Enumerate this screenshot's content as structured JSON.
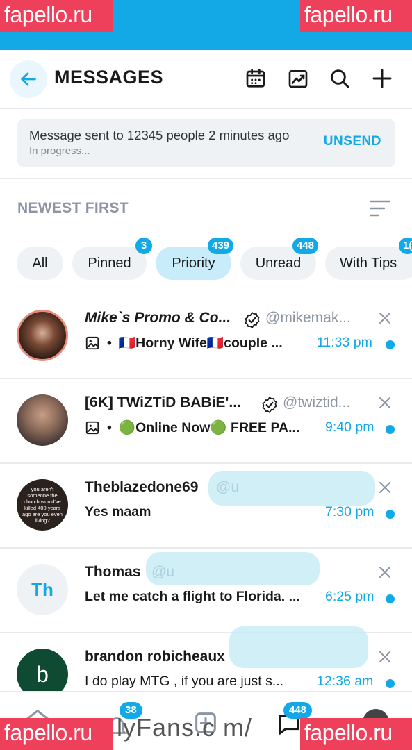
{
  "header": {
    "title": "MESSAGES"
  },
  "banner": {
    "message": "Message sent to 12345 people 2 minutes ago",
    "status": "In progress...",
    "action": "UNSEND"
  },
  "sort": {
    "label": "NEWEST FIRST"
  },
  "filters": [
    {
      "label": "All",
      "badge": null,
      "active": false
    },
    {
      "label": "Pinned",
      "badge": "3",
      "active": false
    },
    {
      "label": "Priority",
      "badge": "439",
      "active": true
    },
    {
      "label": "Unread",
      "badge": "448",
      "active": false
    },
    {
      "label": "With Tips",
      "badge": "1(",
      "active": false
    }
  ],
  "conversations": [
    {
      "name": "Mike`s Promo & Co...",
      "verified": true,
      "handle": "@mikemak...",
      "preview": "🇫🇷Horny Wife🇫🇷couple ...",
      "has_media_icon": true,
      "time": "11:33 pm",
      "unread": true
    },
    {
      "name": "[6K] TWiZTiD BABiE'...",
      "verified": true,
      "handle": "@twiztid...",
      "preview": "🟢Online Now🟢 FREE PA...",
      "has_media_icon": true,
      "time": "9:40 pm",
      "unread": true
    },
    {
      "name": "Theblazedone69",
      "verified": false,
      "handle": "@u",
      "preview": "Yes maam",
      "has_media_icon": false,
      "time": "7:30 pm",
      "unread": true,
      "avatar_text": "you aren't someone the church would've killed 400 years ago are you even living?"
    },
    {
      "name": "Thomas",
      "verified": false,
      "handle": "@u",
      "preview": "Let me catch a flight to Florida. ...",
      "has_media_icon": false,
      "time": "6:25 pm",
      "unread": true,
      "avatar_initials": "Th"
    },
    {
      "name": "brandon robicheaux",
      "verified": false,
      "handle": "",
      "preview": "I do play MTG , if you are just s...",
      "has_media_icon": false,
      "time": "12:36 am",
      "unread": true,
      "avatar_initials": "b"
    }
  ],
  "bottom_nav": {
    "notifications_badge": "38",
    "messages_badge": "448",
    "watermark_text": "lyFans.c m/"
  },
  "watermark": "fapello.ru",
  "colors": {
    "accent": "#12a9e6",
    "watermark": "#ee3f5b"
  }
}
